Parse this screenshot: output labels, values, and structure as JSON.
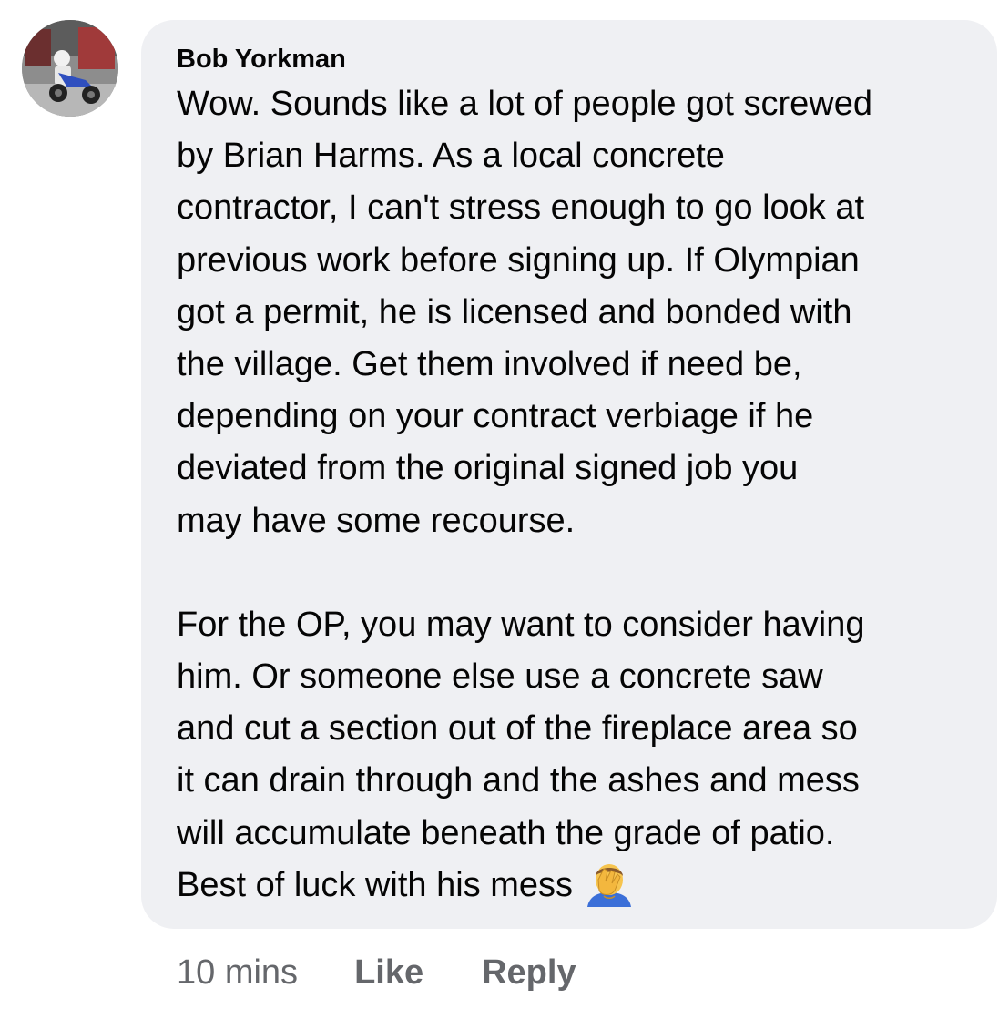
{
  "comment": {
    "author": "Bob Yorkman",
    "paragraph1": "Wow. Sounds like a lot of people got screwed\nby Brian Harms. As a local concrete\ncontractor, I can't stress enough to go look at\nprevious work before signing up. If Olympian\ngot a permit, he is licensed and bonded with\nthe village. Get them involved if need be,\ndepending on your contract verbiage if he\ndeviated from the original signed job you\nmay have some recourse.",
    "paragraph2": "For the OP, you may want to consider having\nhim. Or someone else use a concrete saw\nand cut a section out of the fireplace area so\nit can drain through and the ashes and mess\nwill accumulate beneath the grade of patio.\nBest of luck with his mess",
    "emoji": "facepalm-emoji"
  },
  "actions": {
    "time": "10 mins",
    "like_label": "Like",
    "reply_label": "Reply"
  },
  "colors": {
    "bubble_bg": "#eff0f3",
    "text": "#050505",
    "meta_text": "#65676b"
  }
}
